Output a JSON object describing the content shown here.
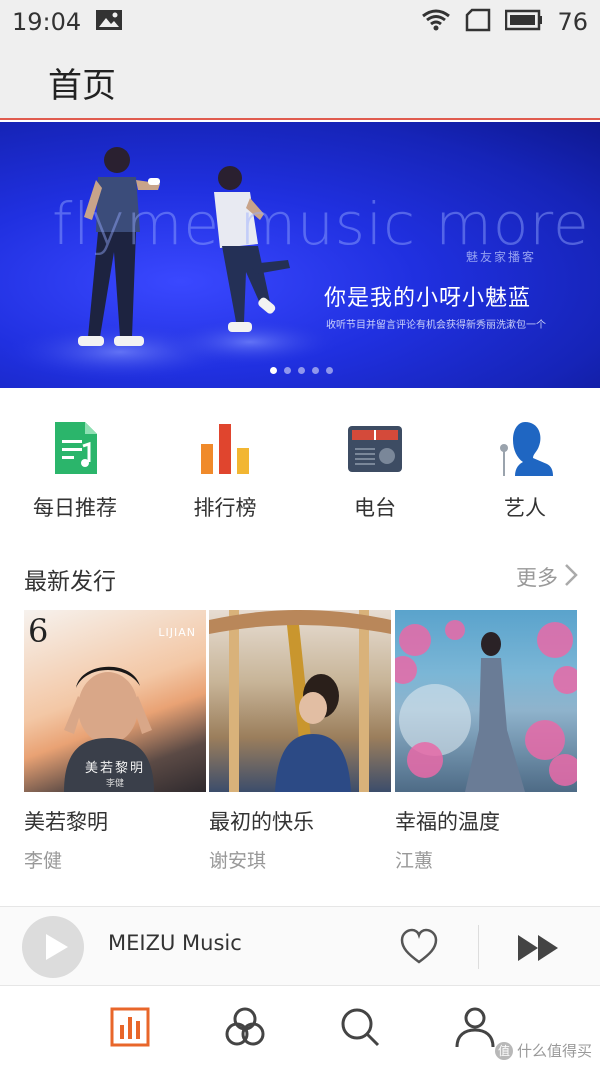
{
  "status_bar": {
    "time": "19:04",
    "battery_level": "76",
    "icons": [
      "image-icon",
      "wifi-icon",
      "sim-icon",
      "battery-icon"
    ]
  },
  "header": {
    "title": "首页",
    "accent_color": "#e05b4e"
  },
  "banner": {
    "big_text": "flyme music more",
    "sub_label": "魅友家播客",
    "headline": "你是我的小呀小魅蓝",
    "caption": "收听节目并留言评论有机会获得新秀丽洗漱包一个",
    "slide_count": 5,
    "active_slide": 1
  },
  "shortcuts": [
    {
      "label": "每日推荐",
      "icon": "daily-recommend-icon"
    },
    {
      "label": "排行榜",
      "icon": "chart-ranking-icon"
    },
    {
      "label": "电台",
      "icon": "radio-icon"
    },
    {
      "label": "艺人",
      "icon": "artist-icon"
    }
  ],
  "new_releases": {
    "title": "最新发行",
    "more_label": "更多",
    "albums": [
      {
        "title": "美若黎明",
        "artist": "李健",
        "cover_text": {
          "number": "6",
          "brand": "LIJIAN",
          "title": "美若黎明",
          "artist": "李健"
        }
      },
      {
        "title": "最初的快乐",
        "artist": "谢安琪"
      },
      {
        "title": "幸福的温度",
        "artist": "江蕙"
      }
    ]
  },
  "mini_player": {
    "title": "MEIZU Music"
  },
  "tabs": [
    {
      "name": "tab-home",
      "icon": "bar-chart-icon",
      "active": true
    },
    {
      "name": "tab-discover",
      "icon": "circles-icon",
      "active": false
    },
    {
      "name": "tab-search",
      "icon": "search-icon",
      "active": false
    },
    {
      "name": "tab-profile",
      "icon": "user-icon",
      "active": false
    }
  ],
  "watermark": {
    "badge": "值",
    "text": "什么值得买"
  },
  "colors": {
    "active_tab": "#e8662a",
    "banner_blue": "#2030e0"
  }
}
